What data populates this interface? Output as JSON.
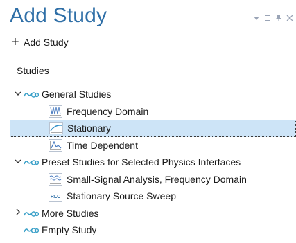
{
  "header": {
    "title": "Add Study",
    "add_label": "Add Study",
    "window_controls": [
      "dropdown",
      "restore",
      "pin",
      "close"
    ]
  },
  "studies": {
    "section_label": "Studies",
    "groups": [
      {
        "label": "General Studies",
        "expanded": true,
        "items": [
          {
            "label": "Frequency Domain",
            "icon": "frequency-domain-icon"
          },
          {
            "label": "Stationary",
            "icon": "stationary-icon",
            "selected": true
          },
          {
            "label": "Time Dependent",
            "icon": "time-dependent-icon"
          }
        ]
      },
      {
        "label": "Preset Studies for Selected Physics Interfaces",
        "expanded": true,
        "items": [
          {
            "label": "Small-Signal Analysis, Frequency Domain",
            "icon": "small-signal-icon"
          },
          {
            "label": "Stationary Source Sweep",
            "icon": "rlc-sweep-icon",
            "icon_text": "RLC"
          }
        ]
      },
      {
        "label": "More Studies",
        "expanded": false,
        "items": []
      },
      {
        "label": "Empty Study",
        "expanded": null,
        "items": []
      }
    ]
  },
  "colors": {
    "title": "#2f6fa7",
    "selection_bg": "#cde4f7",
    "group_icon": "#3aa0c8",
    "icon_blue": "#4a7cc0"
  }
}
